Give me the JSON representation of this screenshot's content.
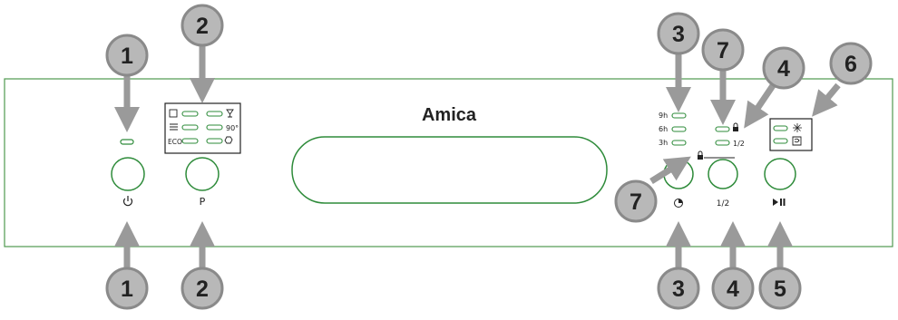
{
  "brand": "Amica",
  "colors": {
    "panel_outline": "#4f9a4f",
    "led_green": "#2e8b3a",
    "callout_fill": "#b8b8b8",
    "callout_stroke": "#8a8a8a",
    "arrow": "#9a9a9a",
    "text": "#222222"
  },
  "labels": {
    "power_icon": "power-icon",
    "program_button": "P",
    "delay_icon": "clock-icon",
    "half_load_button": "1/2",
    "start_pause_icon": "play-pause-icon"
  },
  "program_panel": {
    "eco": "ECO",
    "temp_90": "90°"
  },
  "delay_options": [
    "9h",
    "6h",
    "3h"
  ],
  "half_load_label": "1/2",
  "callouts": {
    "c1_top": "1",
    "c2_top": "2",
    "c3_top": "3",
    "c7_top": "7",
    "c4_top": "4",
    "c6_top": "6",
    "c1_bottom": "1",
    "c2_bottom": "2",
    "c3_bottom": "3",
    "c4_bottom": "4",
    "c5_bottom": "5",
    "c7_mid": "7"
  }
}
